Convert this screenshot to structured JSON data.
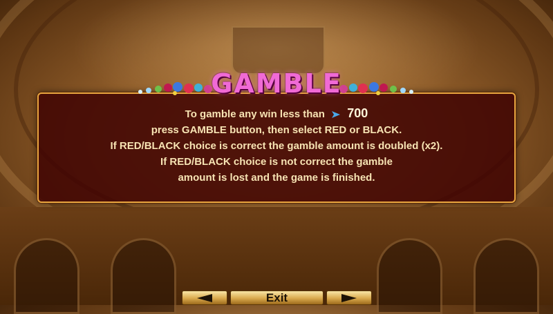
{
  "title": "GAMBLE",
  "info": {
    "line1_text": "To gamble any win less than",
    "line1_icon": "coin-arrow-icon",
    "line1_amount": "700",
    "line2": "press GAMBLE button, then select RED or BLACK.",
    "line3": "If RED/BLACK choice is correct the gamble amount is doubled (x2).",
    "line4": "If RED/BLACK choice is not correct the gamble",
    "line5": "amount is lost and the game is finished."
  },
  "nav": {
    "prev_icon": "arrow-left-icon",
    "exit_label": "Exit",
    "next_icon": "arrow-right-icon"
  },
  "colors": {
    "panel_bg": "#400402",
    "panel_border": "#e9a640",
    "title": "#f06ad6",
    "text": "#f7e3b3"
  }
}
